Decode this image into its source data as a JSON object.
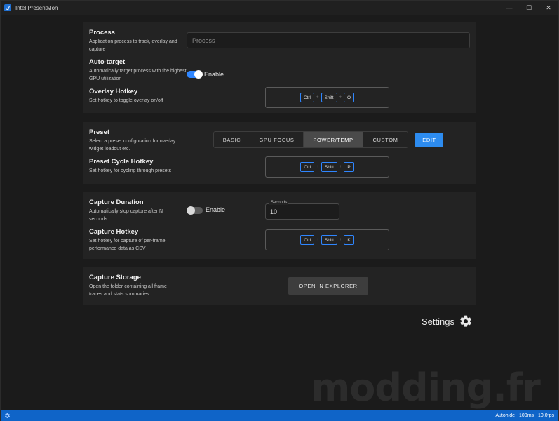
{
  "window": {
    "title": "Intel PresentMon",
    "controls": {
      "minimize": "—",
      "maximize": "☐",
      "close": "✕"
    }
  },
  "process": {
    "title": "Process",
    "description": "Application process to track, overlay and capture",
    "input_placeholder": "Process",
    "input_value": ""
  },
  "auto_target": {
    "title": "Auto-target",
    "description": "Automatically target process with the highest GPU utilization",
    "toggle_label": "Enable",
    "enabled": true
  },
  "overlay_hotkey": {
    "title": "Overlay Hotkey",
    "description": "Set hotkey to toggle overlay on/off",
    "keys": [
      "Ctrl",
      "Shift",
      "O"
    ]
  },
  "preset": {
    "title": "Preset",
    "description": "Select a preset configuration for overlay widget loadout etc.",
    "options": [
      "BASIC",
      "GPU FOCUS",
      "POWER/TEMP",
      "CUSTOM"
    ],
    "selected": "POWER/TEMP",
    "edit_label": "EDIT"
  },
  "preset_cycle_hotkey": {
    "title": "Preset Cycle Hotkey",
    "description": "Set hotkey for cycling through presets",
    "keys": [
      "Ctrl",
      "Shift",
      "P"
    ]
  },
  "capture_duration": {
    "title": "Capture Duration",
    "description": "Automatically stop capture after N seconds",
    "toggle_label": "Enable",
    "enabled": false,
    "field_legend": "Seconds",
    "field_value": "10"
  },
  "capture_hotkey": {
    "title": "Capture Hotkey",
    "description": "Set hotkey for capture of per-frame performance data as CSV",
    "keys": [
      "Ctrl",
      "Shift",
      "K"
    ]
  },
  "capture_storage": {
    "title": "Capture Storage",
    "description": "Open the folder containing all frame traces and stats summaries",
    "button_label": "OPEN IN EXPLORER"
  },
  "settings": {
    "label": "Settings"
  },
  "watermark": "modding.fr",
  "statusbar": {
    "autohide": "Autohide",
    "interval": "100ms",
    "fps": "10.0fps"
  },
  "colors": {
    "accent": "#2f86ff",
    "statusbar": "#0f64c8",
    "panel": "#232323",
    "background": "#1b1b1b"
  }
}
